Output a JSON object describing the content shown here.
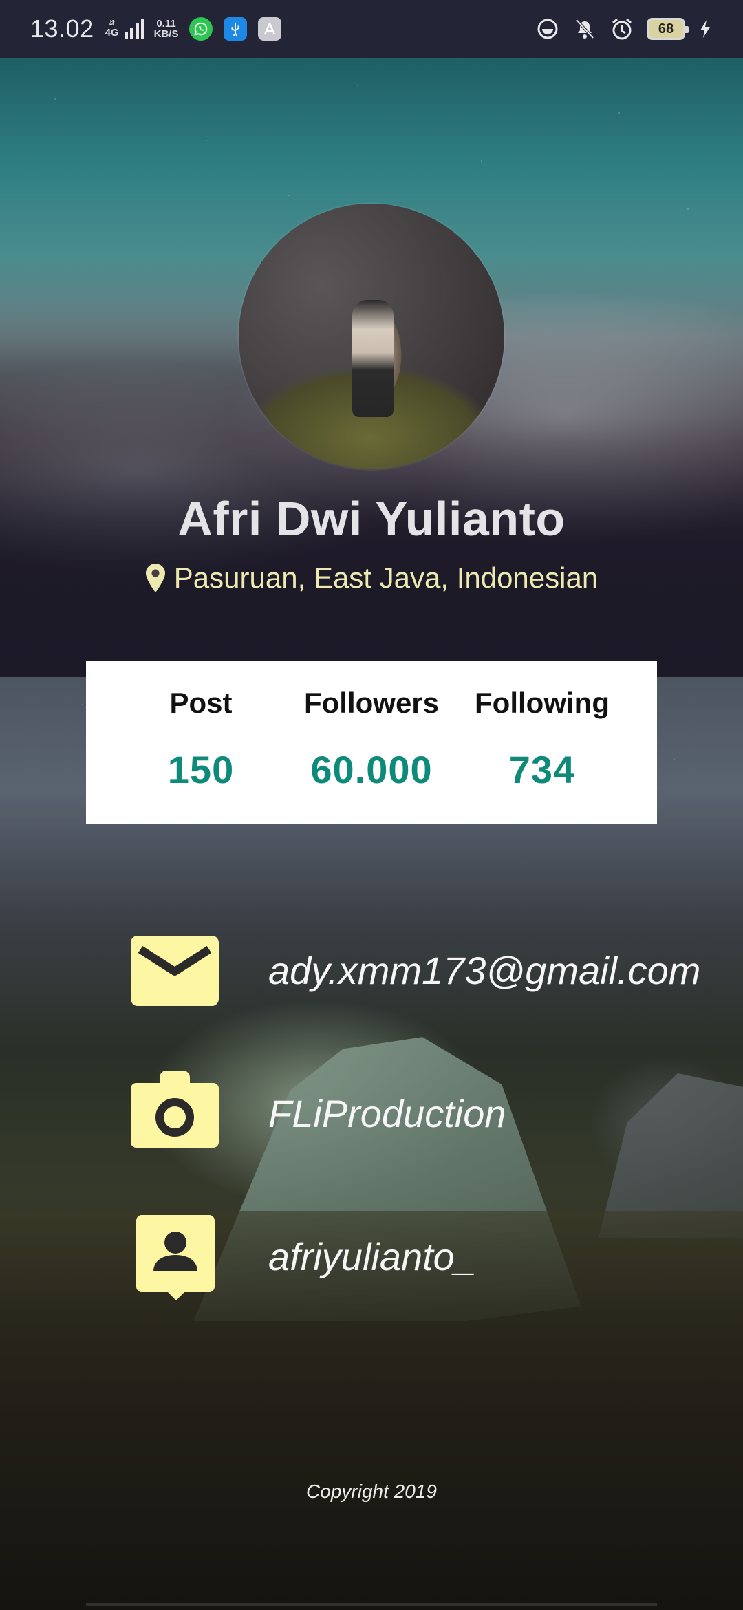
{
  "status_bar": {
    "time": "13.02",
    "network_type": "4G",
    "speed_value": "0.11",
    "speed_unit": "KB/S",
    "battery_level": "68",
    "notification_icons": [
      "whatsapp-icon",
      "usb-icon",
      "app-store-icon"
    ],
    "system_icons": [
      "data-saver-icon",
      "vibrate-off-icon",
      "alarm-icon",
      "battery-icon",
      "charging-icon"
    ]
  },
  "profile": {
    "name": "Afri Dwi Yulianto",
    "location": "Pasuruan, East Java, Indonesian",
    "location_icon": "map-pin-icon"
  },
  "stats": [
    {
      "label": "Post",
      "value": "150"
    },
    {
      "label": "Followers",
      "value": "60.000"
    },
    {
      "label": "Following",
      "value": "734"
    }
  ],
  "contacts": {
    "email": {
      "icon": "email-icon",
      "text": "ady.xmm173@gmail.com"
    },
    "camera": {
      "icon": "camera-icon",
      "text": "FLiProduction"
    },
    "account": {
      "icon": "contact-icon",
      "text": "afriyulianto_"
    }
  },
  "footer": {
    "copyright": "Copyright 2019"
  },
  "colors": {
    "accent": "#0e8a7a",
    "icon_bg": "#fdf7a4",
    "location_text": "#eceab0",
    "status_bar_bg": "#232436"
  }
}
